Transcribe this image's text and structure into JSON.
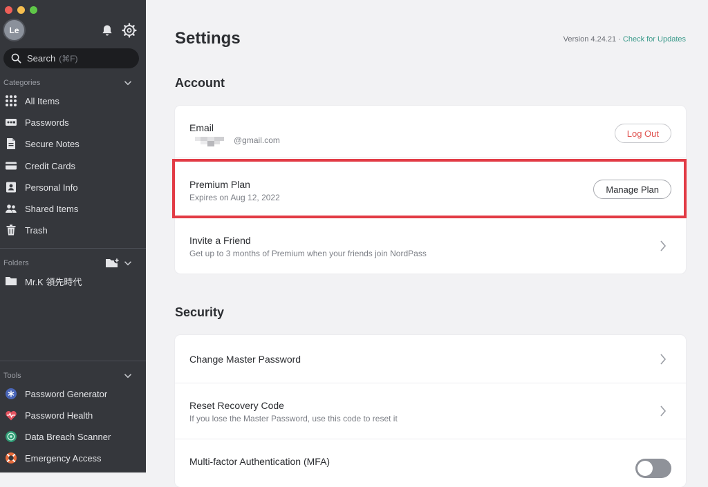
{
  "colors": {
    "sidebar_bg": "#35373c",
    "accent_link": "#3a9a8a",
    "logout_red": "#e0524f",
    "highlight_red": "#e23b45",
    "traffic": [
      "#ee5f58",
      "#f6be4f",
      "#5fc748"
    ]
  },
  "sidebar": {
    "avatar_initials": "Le",
    "search": {
      "placeholder": "Search",
      "shortcut": "(⌘F)"
    },
    "categories_label": "Categories",
    "categories": [
      {
        "label": "All Items",
        "icon": "grid-icon"
      },
      {
        "label": "Passwords",
        "icon": "password-icon"
      },
      {
        "label": "Secure Notes",
        "icon": "note-icon"
      },
      {
        "label": "Credit Cards",
        "icon": "credit-card-icon"
      },
      {
        "label": "Personal Info",
        "icon": "id-card-icon"
      },
      {
        "label": "Shared Items",
        "icon": "users-icon"
      },
      {
        "label": "Trash",
        "icon": "trash-icon"
      }
    ],
    "folders_label": "Folders",
    "folders": [
      {
        "label": "Mr.K 領先時代",
        "icon": "folder-icon"
      }
    ],
    "tools_label": "Tools",
    "tools": [
      {
        "label": "Password Generator",
        "icon": "generator-icon"
      },
      {
        "label": "Password Health",
        "icon": "health-icon"
      },
      {
        "label": "Data Breach Scanner",
        "icon": "scanner-icon"
      },
      {
        "label": "Emergency Access",
        "icon": "lifebuoy-icon"
      }
    ]
  },
  "main": {
    "title": "Settings",
    "version_text": "Version 4.24.21 · ",
    "check_updates": "Check for Updates",
    "account": {
      "heading": "Account",
      "email_title": "Email",
      "email_value": "@gmail.com",
      "logout_label": "Log Out",
      "plan_title": "Premium Plan",
      "plan_expiry": "Expires on Aug 12, 2022",
      "manage_label": "Manage Plan",
      "invite_title": "Invite a Friend",
      "invite_desc": "Get up to 3 months of Premium when your friends join NordPass"
    },
    "security": {
      "heading": "Security",
      "change_pw_title": "Change Master Password",
      "recovery_title": "Reset Recovery Code",
      "recovery_desc": "If you lose the Master Password, use this code to reset it",
      "mfa_title": "Multi-factor Authentication (MFA)",
      "mfa_enabled": false
    }
  }
}
